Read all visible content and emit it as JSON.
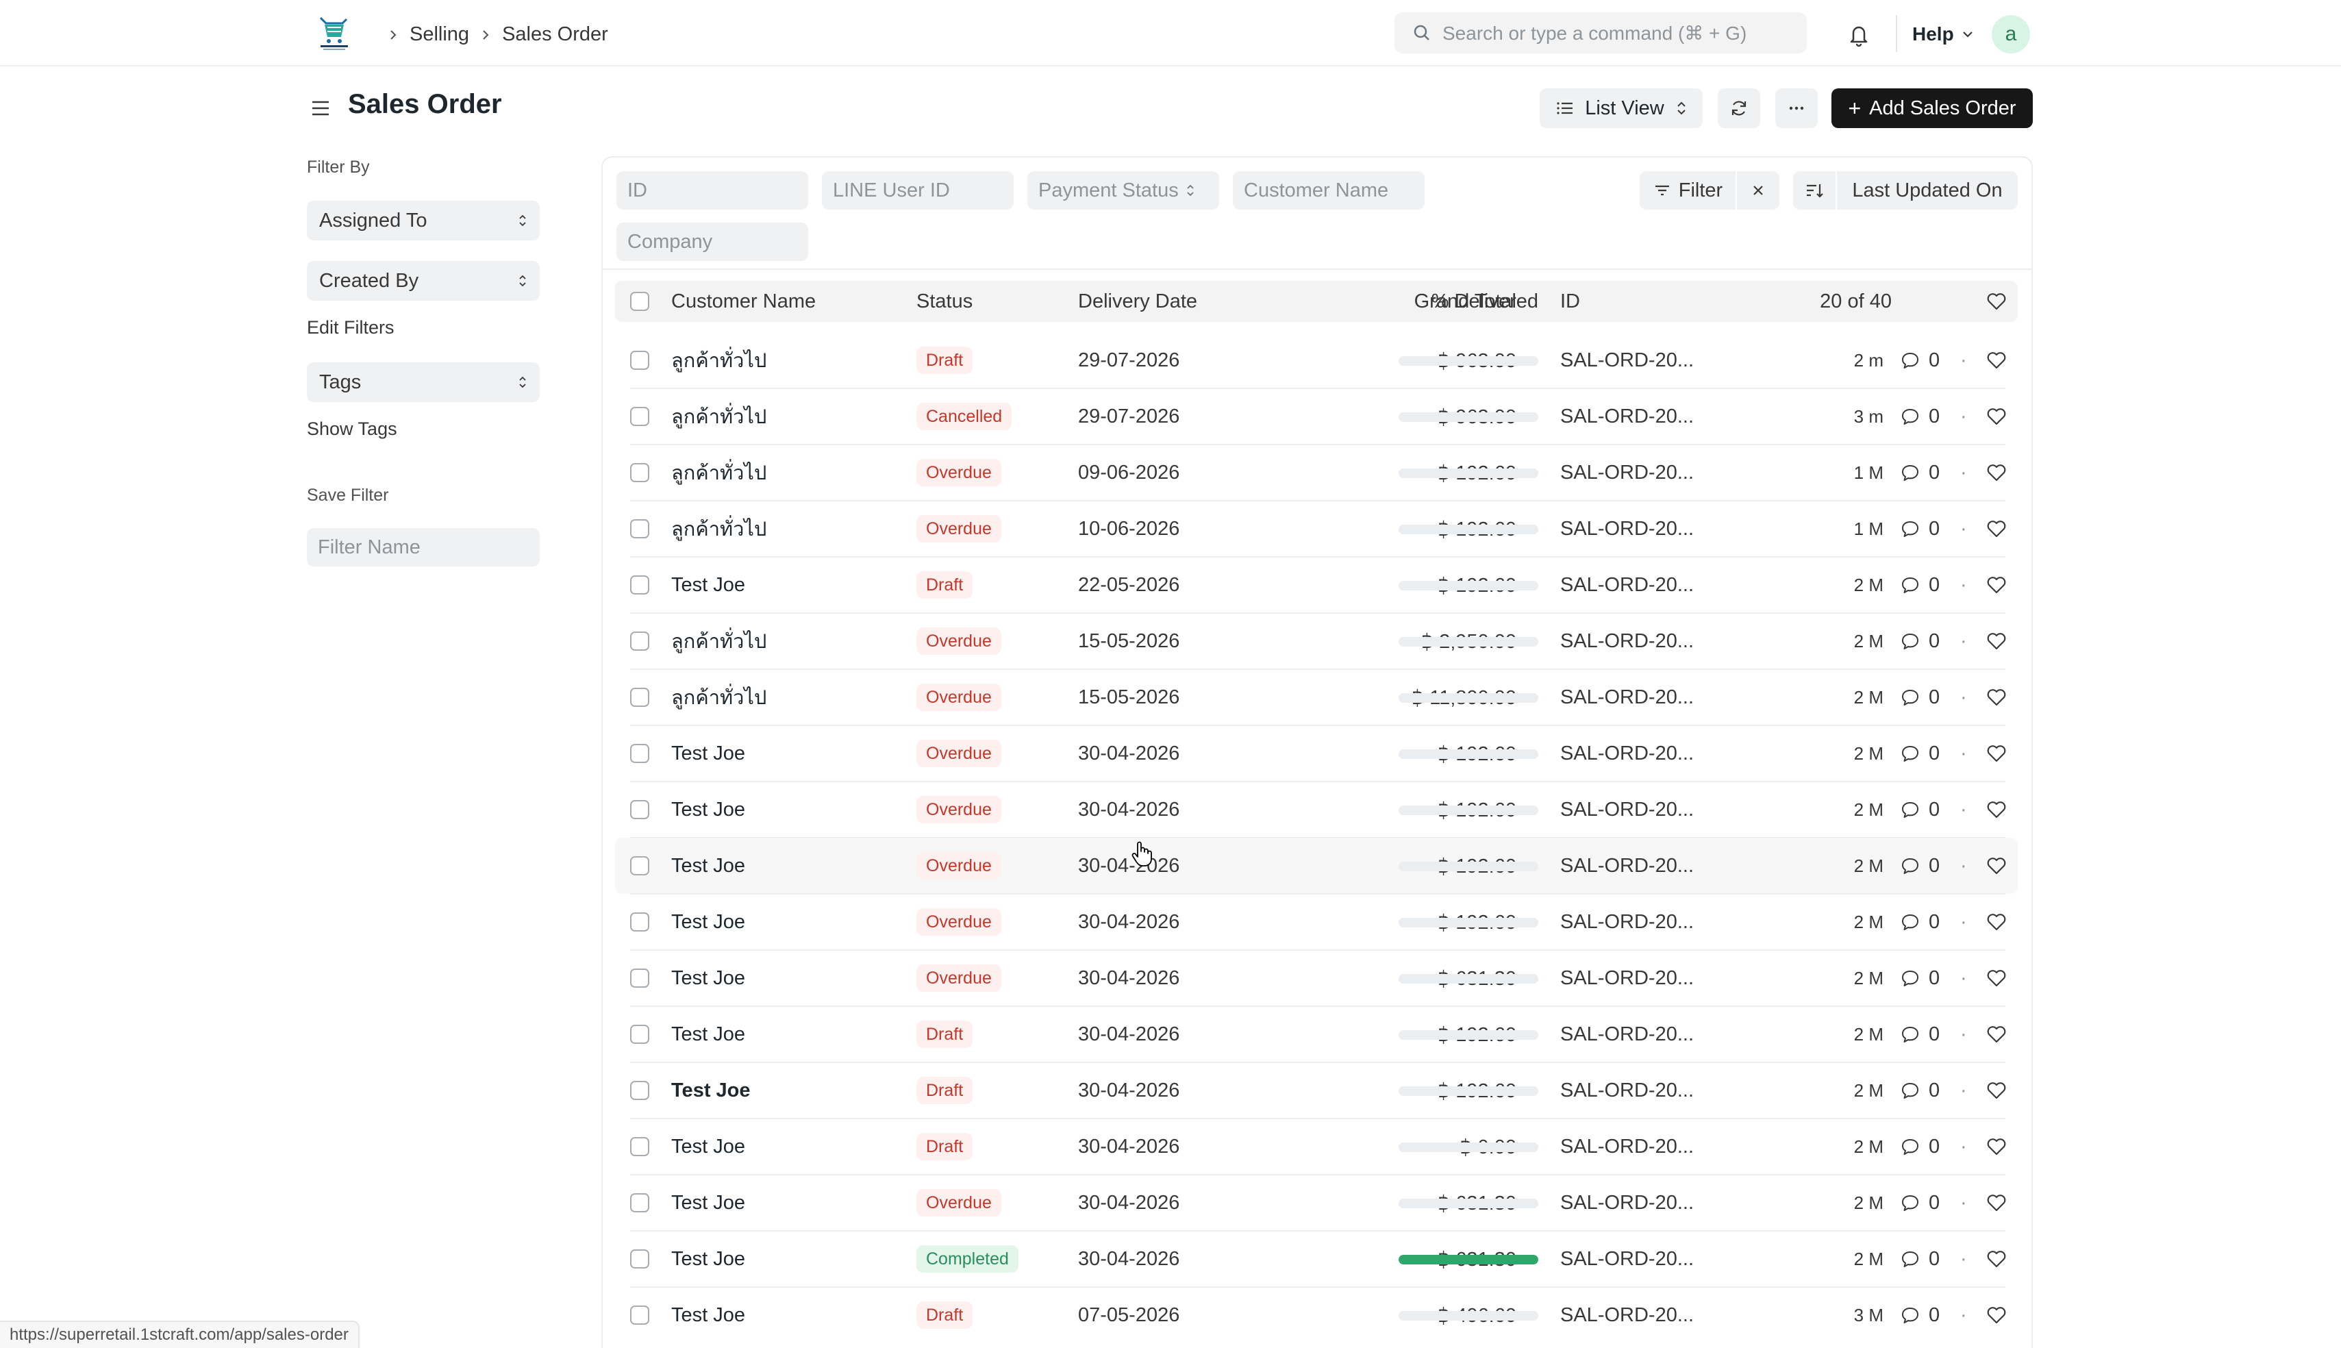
{
  "navbar": {
    "breadcrumbs": [
      "Selling",
      "Sales Order"
    ],
    "search_placeholder": "Search or type a command (⌘ + G)",
    "help_label": "Help",
    "avatar_initial": "a",
    "logo_icon": "super-retail-cart-logo"
  },
  "page": {
    "title": "Sales Order",
    "list_view_label": "List View",
    "add_button_label": "Add Sales Order",
    "more_label": "···"
  },
  "sidebar": {
    "filter_by_label": "Filter By",
    "assigned_to": "Assigned To",
    "created_by": "Created By",
    "edit_filters": "Edit Filters",
    "tags": "Tags",
    "show_tags": "Show Tags",
    "save_filter_label": "Save Filter",
    "filter_name_placeholder": "Filter Name"
  },
  "filters": {
    "id_placeholder": "ID",
    "line_user_placeholder": "LINE User ID",
    "payment_status_placeholder": "Payment Status",
    "customer_name_placeholder": "Customer Name",
    "company_placeholder": "Company",
    "filter_label": "Filter",
    "sort_label": "Last Updated On"
  },
  "table": {
    "columns": {
      "customer": "Customer Name",
      "status": "Status",
      "delivery_date": "Delivery Date",
      "grand_total": "Grand Total",
      "delivered": "% Delivered",
      "id": "ID"
    },
    "count": "20 of 40",
    "rows": [
      {
        "customer": "ลูกค้าทั่วไป",
        "status": "Draft",
        "status_kind": "draft",
        "date": "29-07-2026",
        "total": "฿ 963.00",
        "delivered": 0,
        "id": "SAL-ORD-20...",
        "modified": "2 m",
        "comments": "0"
      },
      {
        "customer": "ลูกค้าทั่วไป",
        "status": "Cancelled",
        "status_kind": "cancelled",
        "date": "29-07-2026",
        "total": "฿ 963.00",
        "delivered": 0,
        "id": "SAL-ORD-20...",
        "modified": "3 m",
        "comments": "0"
      },
      {
        "customer": "ลูกค้าทั่วไป",
        "status": "Overdue",
        "status_kind": "overdue",
        "date": "09-06-2026",
        "total": "฿ 192.60",
        "delivered": 0,
        "id": "SAL-ORD-20...",
        "modified": "1 M",
        "comments": "0"
      },
      {
        "customer": "ลูกค้าทั่วไป",
        "status": "Overdue",
        "status_kind": "overdue",
        "date": "10-06-2026",
        "total": "฿ 192.60",
        "delivered": 0,
        "id": "SAL-ORD-20...",
        "modified": "1 M",
        "comments": "0"
      },
      {
        "customer": "Test Joe",
        "status": "Draft",
        "status_kind": "draft",
        "date": "22-05-2026",
        "total": "฿ 192.60",
        "delivered": 0,
        "id": "SAL-ORD-20...",
        "modified": "2 M",
        "comments": "0"
      },
      {
        "customer": "ลูกค้าทั่วไป",
        "status": "Overdue",
        "status_kind": "overdue",
        "date": "15-05-2026",
        "total": "฿ 2,950.00",
        "delivered": 0,
        "id": "SAL-ORD-20...",
        "modified": "2 M",
        "comments": "0"
      },
      {
        "customer": "ลูกค้าทั่วไป",
        "status": "Overdue",
        "status_kind": "overdue",
        "date": "15-05-2026",
        "total": "฿ 11,800.00",
        "delivered": 0,
        "id": "SAL-ORD-20...",
        "modified": "2 M",
        "comments": "0"
      },
      {
        "customer": "Test Joe",
        "status": "Overdue",
        "status_kind": "overdue",
        "date": "30-04-2026",
        "total": "฿ 192.60",
        "delivered": 0,
        "id": "SAL-ORD-20...",
        "modified": "2 M",
        "comments": "0"
      },
      {
        "customer": "Test Joe",
        "status": "Overdue",
        "status_kind": "overdue",
        "date": "30-04-2026",
        "total": "฿ 192.60",
        "delivered": 0,
        "id": "SAL-ORD-20...",
        "modified": "2 M",
        "comments": "0"
      },
      {
        "customer": "Test Joe",
        "status": "Overdue",
        "status_kind": "overdue",
        "date": "30-04-2026",
        "total": "฿ 192.60",
        "delivered": 0,
        "id": "SAL-ORD-20...",
        "modified": "2 M",
        "comments": "0",
        "hover": true
      },
      {
        "customer": "Test Joe",
        "status": "Overdue",
        "status_kind": "overdue",
        "date": "30-04-2026",
        "total": "฿ 192.60",
        "delivered": 0,
        "id": "SAL-ORD-20...",
        "modified": "2 M",
        "comments": "0"
      },
      {
        "customer": "Test Joe",
        "status": "Overdue",
        "status_kind": "overdue",
        "date": "30-04-2026",
        "total": "฿ 631.30",
        "delivered": 0,
        "id": "SAL-ORD-20...",
        "modified": "2 M",
        "comments": "0"
      },
      {
        "customer": "Test Joe",
        "status": "Draft",
        "status_kind": "draft",
        "date": "30-04-2026",
        "total": "฿ 192.60",
        "delivered": 0,
        "id": "SAL-ORD-20...",
        "modified": "2 M",
        "comments": "0"
      },
      {
        "customer": "Test Joe",
        "status": "Draft",
        "status_kind": "draft",
        "date": "30-04-2026",
        "total": "฿ 192.60",
        "delivered": 0,
        "id": "SAL-ORD-20...",
        "modified": "2 M",
        "comments": "0",
        "bold": true
      },
      {
        "customer": "Test Joe",
        "status": "Draft",
        "status_kind": "draft",
        "date": "30-04-2026",
        "total": "฿ 0.00",
        "delivered": 0,
        "id": "SAL-ORD-20...",
        "modified": "2 M",
        "comments": "0"
      },
      {
        "customer": "Test Joe",
        "status": "Overdue",
        "status_kind": "overdue",
        "date": "30-04-2026",
        "total": "฿ 631.30",
        "delivered": 0,
        "id": "SAL-ORD-20...",
        "modified": "2 M",
        "comments": "0"
      },
      {
        "customer": "Test Joe",
        "status": "Completed",
        "status_kind": "completed",
        "date": "30-04-2026",
        "total": "฿ 631.30",
        "delivered": 100,
        "id": "SAL-ORD-20...",
        "modified": "2 M",
        "comments": "0"
      },
      {
        "customer": "Test Joe",
        "status": "Draft",
        "status_kind": "draft",
        "date": "07-05-2026",
        "total": "฿ 406.60",
        "delivered": 0,
        "id": "SAL-ORD-20...",
        "modified": "3 M",
        "comments": "0"
      }
    ]
  },
  "status_bar": {
    "url": "https://superretail.1stcraft.com/app/sales-order"
  },
  "colors": {
    "accent": "#171717",
    "status_red": "#c0392b",
    "status_green": "#278f5e",
    "progress_green": "#30a66d"
  }
}
